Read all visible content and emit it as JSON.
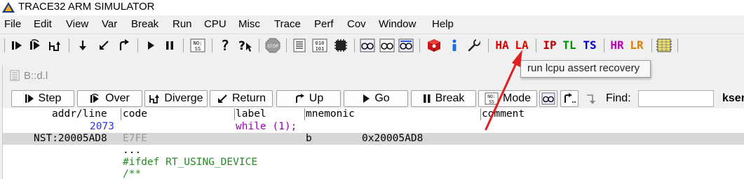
{
  "window": {
    "title": "TRACE32 ARM SIMULATOR"
  },
  "menu": [
    "File",
    "Edit",
    "View",
    "Var",
    "Break",
    "Run",
    "CPU",
    "Misc",
    "Trace",
    "Perf",
    "Cov",
    "Window",
    "Help"
  ],
  "toolbar": {
    "nos_label": "NO:\nSS",
    "stop_label": "STOP",
    "mem_label": "010\n101",
    "text_buttons": [
      {
        "label": "HA",
        "color": "#e00000"
      },
      {
        "label": "LA",
        "color": "#e00000"
      },
      {
        "label": "IP",
        "color": "#c00000"
      },
      {
        "label": "TL",
        "color": "#009000"
      },
      {
        "label": "TS",
        "color": "#0000c8"
      },
      {
        "label": "HR",
        "color": "#c000c0"
      },
      {
        "label": "LR",
        "color": "#e08000"
      }
    ]
  },
  "tooltip": {
    "text": "run lcpu assert recovery"
  },
  "inner_window": {
    "title": "B::d.l",
    "buttons": [
      "Step",
      "Over",
      "Diverge",
      "Return",
      "Up",
      "Go",
      "Break",
      "Mode"
    ],
    "find_label": "Find:",
    "find_value": "",
    "find_suffix": "kser"
  },
  "listing": {
    "headers": {
      "addr_line": "addr/line",
      "code": "code",
      "label": "label",
      "mnemonic": "mnemonic",
      "comment": "comment"
    },
    "rows": [
      {
        "addr": "2073",
        "code": "",
        "label": "while (1);",
        "mnemonic": "",
        "operand": ""
      },
      {
        "addr": "NST:20005AD8",
        "code": "E7FE",
        "label": "",
        "mnemonic": "b",
        "operand": "0x20005AD8"
      },
      {
        "addr": "",
        "code": "...",
        "label": "",
        "mnemonic": "",
        "operand": ""
      },
      {
        "addr": "",
        "code": "#ifdef RT_USING_DEVICE",
        "label": "",
        "mnemonic": "",
        "operand": ""
      },
      {
        "addr": "",
        "code": "/**",
        "label": "",
        "mnemonic": "",
        "operand": ""
      }
    ]
  },
  "colors": {
    "accent_red": "#e00000",
    "source_blue": "#3030e0",
    "source_green": "#238b23",
    "annotation_arrow": "#e02020"
  }
}
